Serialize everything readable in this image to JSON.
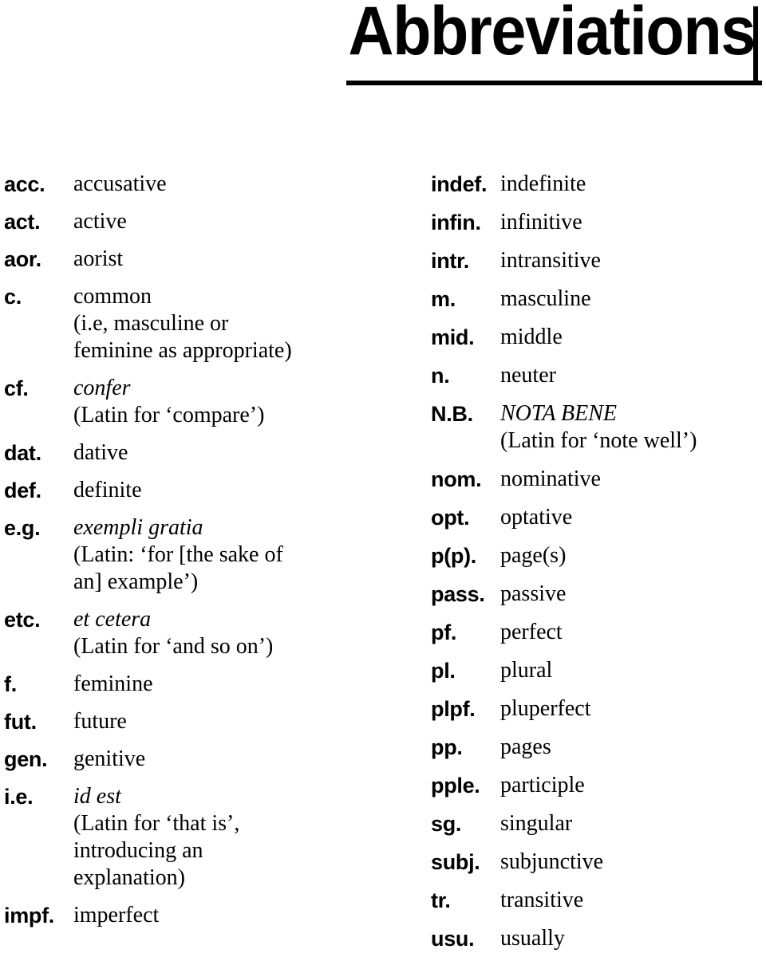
{
  "header": {
    "title": "Abbreviations"
  },
  "columns": {
    "left": [
      {
        "abbr": "acc.",
        "lines": [
          {
            "text": "accusative",
            "style": "roman"
          }
        ]
      },
      {
        "abbr": "act.",
        "lines": [
          {
            "text": "active",
            "style": "roman"
          }
        ]
      },
      {
        "abbr": "aor.",
        "lines": [
          {
            "text": "aorist",
            "style": "roman"
          }
        ]
      },
      {
        "abbr": "c.",
        "lines": [
          {
            "text": "common",
            "style": "roman"
          },
          {
            "text": "(i.e, masculine or",
            "style": "roman"
          },
          {
            "text": "feminine as appropriate)",
            "style": "roman"
          }
        ]
      },
      {
        "abbr": "cf.",
        "lines": [
          {
            "text": "confer",
            "style": "italic"
          },
          {
            "text": "(Latin for ‘compare’)",
            "style": "roman"
          }
        ]
      },
      {
        "abbr": "dat.",
        "lines": [
          {
            "text": "dative",
            "style": "roman"
          }
        ]
      },
      {
        "abbr": "def.",
        "lines": [
          {
            "text": "definite",
            "style": "roman"
          }
        ]
      },
      {
        "abbr": "e.g.",
        "lines": [
          {
            "text": "exempli gratia",
            "style": "italic"
          },
          {
            "text": "(Latin: ‘for [the sake of",
            "style": "roman"
          },
          {
            "text": "an] example’)",
            "style": "roman"
          }
        ]
      },
      {
        "abbr": "etc.",
        "lines": [
          {
            "text": "et cetera",
            "style": "italic"
          },
          {
            "text": "(Latin for ‘and so on’)",
            "style": "roman"
          }
        ]
      },
      {
        "abbr": "f.",
        "lines": [
          {
            "text": "feminine",
            "style": "roman"
          }
        ]
      },
      {
        "abbr": "fut.",
        "lines": [
          {
            "text": "future",
            "style": "roman"
          }
        ]
      },
      {
        "abbr": "gen.",
        "lines": [
          {
            "text": "genitive",
            "style": "roman"
          }
        ]
      },
      {
        "abbr": "i.e.",
        "lines": [
          {
            "text": "id est",
            "style": "italic"
          },
          {
            "text": "(Latin for ‘that is’,",
            "style": "roman"
          },
          {
            "text": "introducing an",
            "style": "roman"
          },
          {
            "text": "explanation)",
            "style": "roman"
          }
        ]
      },
      {
        "abbr": "impf.",
        "lines": [
          {
            "text": "imperfect",
            "style": "roman"
          }
        ]
      }
    ],
    "right": [
      {
        "abbr": "indef.",
        "lines": [
          {
            "text": "indefinite",
            "style": "roman"
          }
        ]
      },
      {
        "abbr": "infin.",
        "lines": [
          {
            "text": "infinitive",
            "style": "roman"
          }
        ]
      },
      {
        "abbr": "intr.",
        "lines": [
          {
            "text": "intransitive",
            "style": "roman"
          }
        ]
      },
      {
        "abbr": "m.",
        "lines": [
          {
            "text": "masculine",
            "style": "roman"
          }
        ]
      },
      {
        "abbr": "mid.",
        "lines": [
          {
            "text": "middle",
            "style": "roman"
          }
        ]
      },
      {
        "abbr": "n.",
        "lines": [
          {
            "text": "neuter",
            "style": "roman"
          }
        ]
      },
      {
        "abbr": "N.B.",
        "lines": [
          {
            "text": "NOTA BENE",
            "style": "italic"
          },
          {
            "text": "(Latin for ‘note well’)",
            "style": "roman"
          }
        ]
      },
      {
        "abbr": "nom.",
        "lines": [
          {
            "text": "nominative",
            "style": "roman"
          }
        ]
      },
      {
        "abbr": "opt.",
        "lines": [
          {
            "text": "optative",
            "style": "roman"
          }
        ]
      },
      {
        "abbr": "p(p).",
        "lines": [
          {
            "text": "page(s)",
            "style": "roman"
          }
        ]
      },
      {
        "abbr": "pass.",
        "lines": [
          {
            "text": "passive",
            "style": "roman"
          }
        ]
      },
      {
        "abbr": "pf.",
        "lines": [
          {
            "text": "perfect",
            "style": "roman"
          }
        ]
      },
      {
        "abbr": "pl.",
        "lines": [
          {
            "text": "plural",
            "style": "roman"
          }
        ]
      },
      {
        "abbr": "plpf.",
        "lines": [
          {
            "text": "pluperfect",
            "style": "roman"
          }
        ]
      },
      {
        "abbr": "pp.",
        "lines": [
          {
            "text": "pages",
            "style": "roman"
          }
        ]
      },
      {
        "abbr": "pple.",
        "lines": [
          {
            "text": "participle",
            "style": "roman"
          }
        ]
      },
      {
        "abbr": "sg.",
        "lines": [
          {
            "text": "singular",
            "style": "roman"
          }
        ]
      },
      {
        "abbr": "subj.",
        "lines": [
          {
            "text": "subjunctive",
            "style": "roman"
          }
        ]
      },
      {
        "abbr": "tr.",
        "lines": [
          {
            "text": "transitive",
            "style": "roman"
          }
        ]
      },
      {
        "abbr": "usu.",
        "lines": [
          {
            "text": "usually",
            "style": "roman"
          }
        ]
      }
    ]
  }
}
